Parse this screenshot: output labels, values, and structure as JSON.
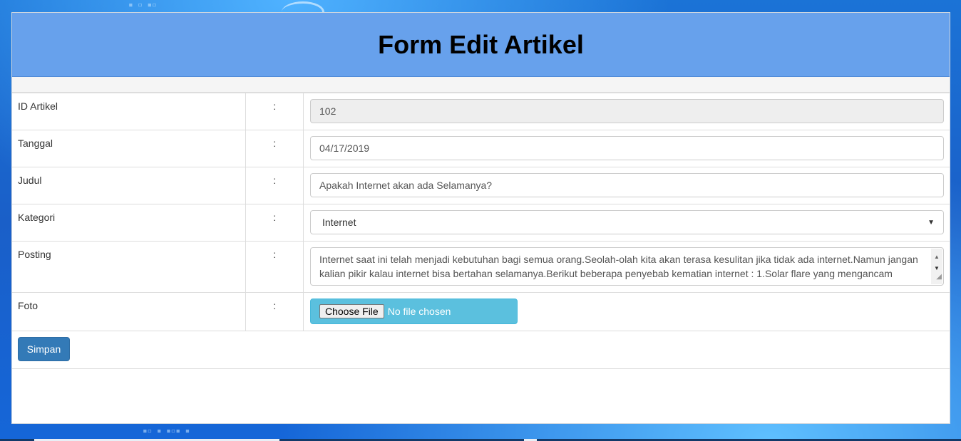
{
  "page": {
    "title": "Form Edit Artikel"
  },
  "form": {
    "colon": ":",
    "id": {
      "label": "ID Artikel",
      "value": "102"
    },
    "tanggal": {
      "label": "Tanggal",
      "value": "04/17/2019"
    },
    "judul": {
      "label": "Judul",
      "value": "Apakah Internet akan ada Selamanya?"
    },
    "kategori": {
      "label": "Kategori",
      "selected": "Internet"
    },
    "posting": {
      "label": "Posting",
      "value": "Internet saat ini telah menjadi kebutuhan bagi semua orang.Seolah-olah kita akan terasa kesulitan jika tidak ada internet.Namun jangan kalian pikir kalau internet bisa bertahan selamanya.Berikut beberapa penyebab kematian internet : 1.Solar flare yang mengancam"
    },
    "foto": {
      "label": "Foto",
      "button": "Choose File",
      "status": "No file chosen"
    },
    "submit_label": "Simpan"
  },
  "colors": {
    "header": "#67a1ec",
    "primary_button": "#337ab7",
    "file_input_bg": "#5bc0de"
  }
}
